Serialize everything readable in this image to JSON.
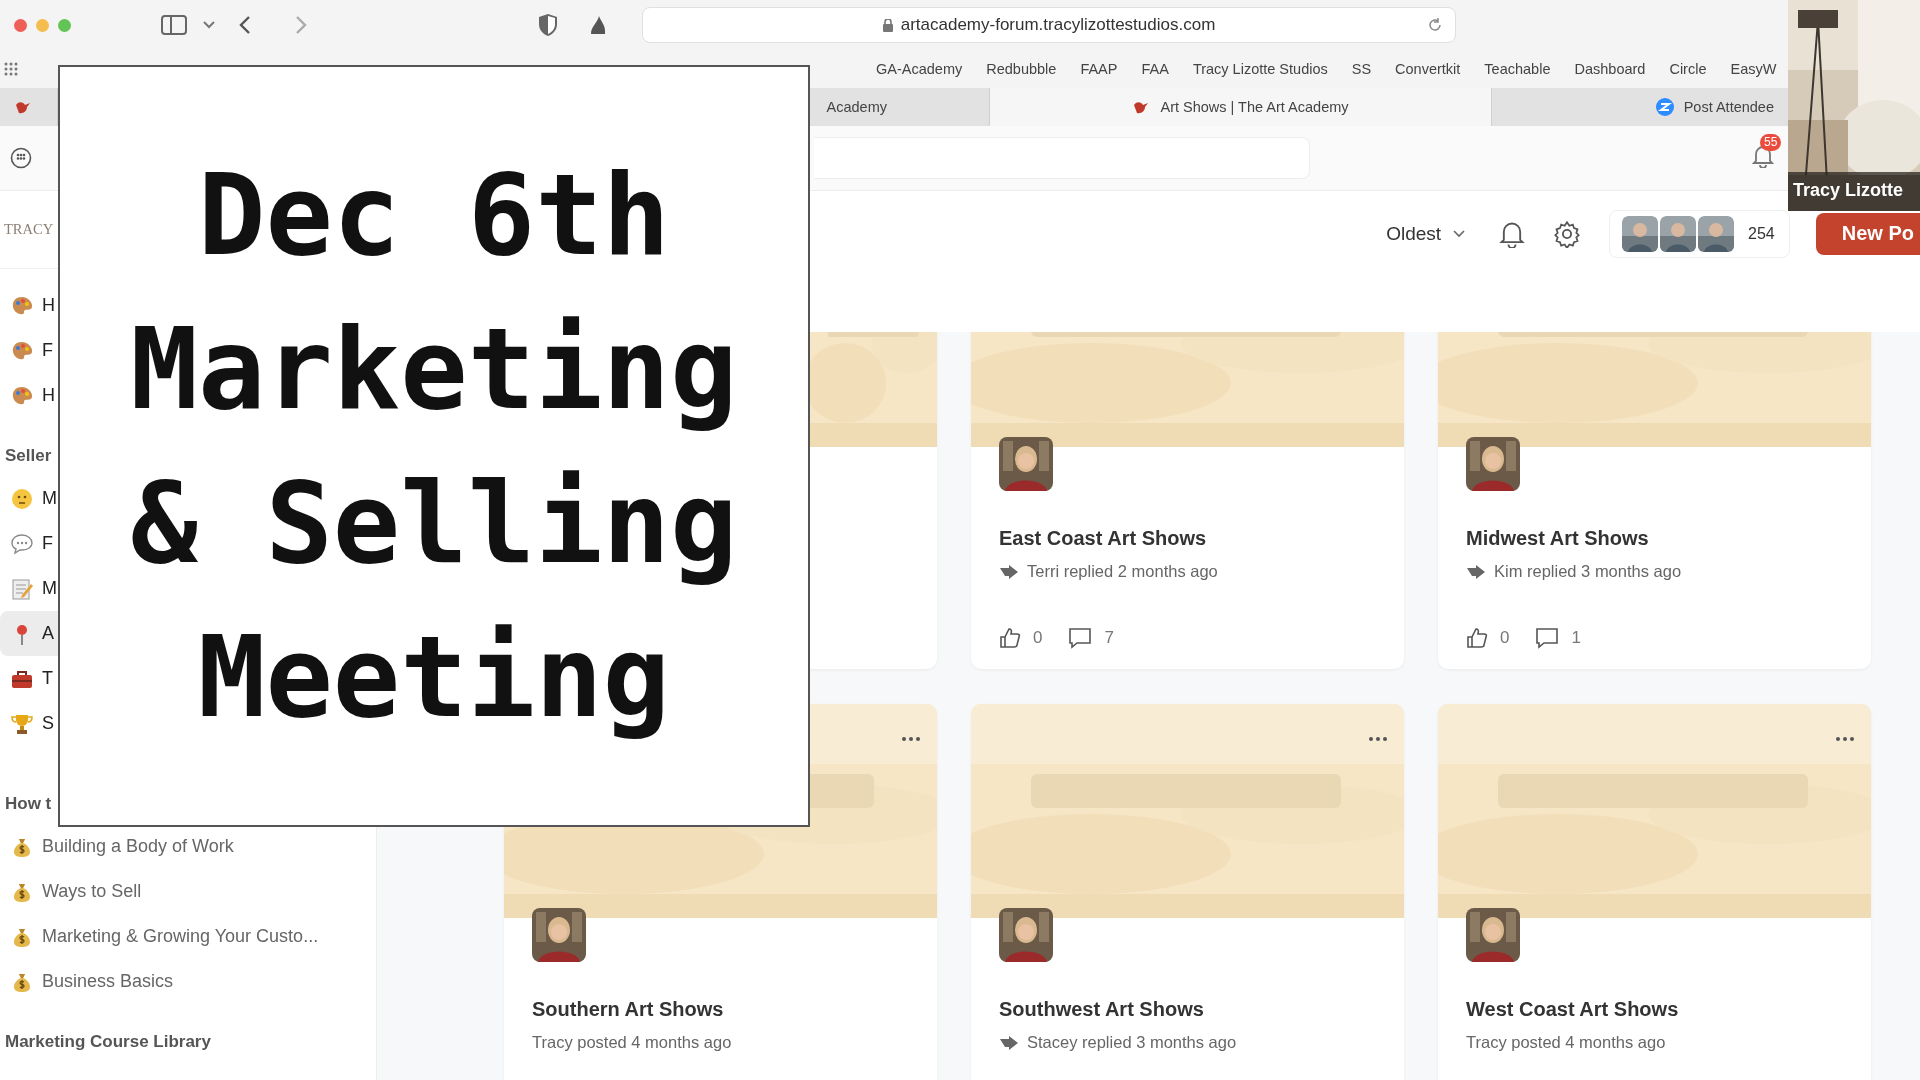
{
  "browser": {
    "address": "artacademy-forum.tracylizottestudios.com",
    "bookmarks": [
      "GA-Academy",
      "Redbubble",
      "FAAP",
      "FAA",
      "Tracy Lizotte Studios",
      "SS",
      "Convertkit",
      "Teachable",
      "Dashboard",
      "Circle",
      "EasyW"
    ],
    "tabs": [
      {
        "selected": false
      },
      {
        "label": "Academy",
        "selected": false
      },
      {
        "label": "Art Shows | The Art Academy",
        "selected": true
      },
      {
        "label": "Post Attendee",
        "selected": false
      }
    ]
  },
  "app": {
    "notification_count": "55"
  },
  "sidebar": {
    "logo": "TRACY",
    "sections": [
      {
        "items": [
          {
            "label": "H",
            "selected": false
          },
          {
            "label": "F",
            "selected": false
          },
          {
            "label": "H",
            "selected": false
          }
        ]
      },
      {
        "title": "Seller",
        "items": [
          {
            "label": "M",
            "selected": false
          },
          {
            "label": "F",
            "selected": false
          },
          {
            "label": "M",
            "selected": false
          },
          {
            "label": "A",
            "selected": true
          },
          {
            "label": "T",
            "selected": false
          },
          {
            "label": "S",
            "selected": false
          }
        ]
      },
      {
        "title": "How t",
        "items": [
          {
            "label": "Building a Body of Work",
            "selected": false
          },
          {
            "label": "Ways to Sell",
            "selected": false
          },
          {
            "label": "Marketing & Growing Your Custo...",
            "selected": false
          },
          {
            "label": "Business Basics",
            "selected": false
          }
        ]
      },
      {
        "title": "Marketing Course Library"
      }
    ]
  },
  "header": {
    "sort": "Oldest",
    "member_count": "254",
    "new_post": "New Po"
  },
  "posts": [
    {
      "kind": "picture"
    },
    {
      "title": "East Coast Art Shows",
      "meta": "Terri replied 2 months ago",
      "kind": "reply",
      "likes": "0",
      "comments": "7"
    },
    {
      "title": "Midwest Art Shows",
      "meta": "Kim replied 3 months ago",
      "kind": "reply",
      "likes": "0",
      "comments": "1"
    },
    {
      "title": "Southern Art Shows",
      "meta": "Tracy posted 4 months ago",
      "kind": "post"
    },
    {
      "title": "Southwest Art Shows",
      "meta": "Stacey replied 3 months ago",
      "kind": "reply"
    },
    {
      "title": "West Coast Art Shows",
      "meta": "Tracy posted 4 months ago",
      "kind": "post"
    }
  ],
  "video": {
    "name": "Tracy Lizotte"
  },
  "title_card": {
    "lines": [
      "Dec 6th",
      "Marketing",
      "& Selling",
      "Meeting"
    ]
  }
}
